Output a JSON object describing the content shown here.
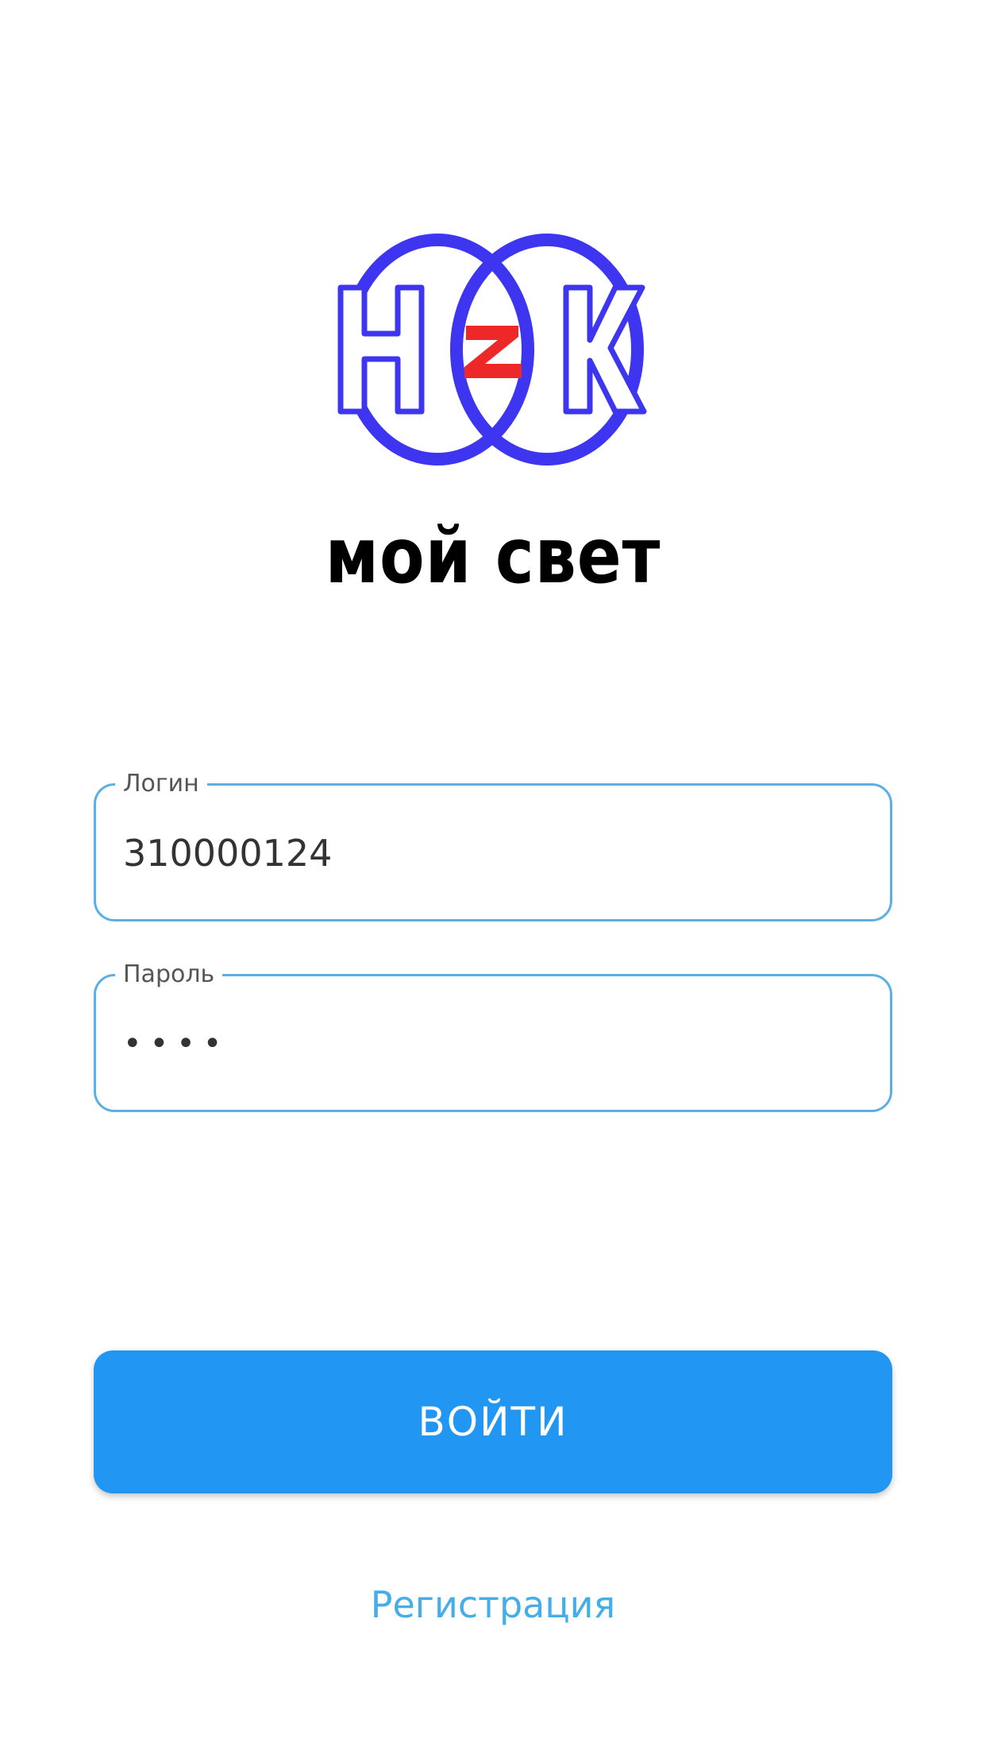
{
  "app": {
    "brand_title": "мой свет"
  },
  "login_form": {
    "login_label": "Логин",
    "login_value": "310000124",
    "password_label": "Пароль",
    "password_value": "••••"
  },
  "actions": {
    "submit_label": "ВОЙТИ",
    "register_label": "Регистрация"
  },
  "colors": {
    "logo_blue": "#3d35f0",
    "logo_red": "#ee2828",
    "field_border": "#5aafe6",
    "button_bg": "#2196f3",
    "link": "#45aee8"
  }
}
